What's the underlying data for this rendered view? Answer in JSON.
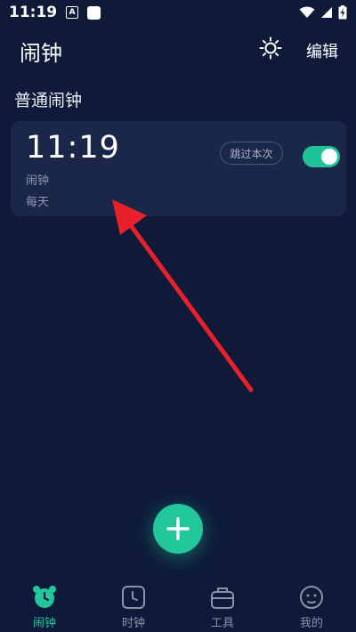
{
  "status_bar": {
    "time": "11:19",
    "badge_letter": "A"
  },
  "header": {
    "title": "闹钟",
    "edit_label": "编辑"
  },
  "section": {
    "title": "普通闹钟"
  },
  "alarm": {
    "time": "11:19",
    "label": "闹钟",
    "repeat": "每天",
    "skip_label": "跳过本次",
    "enabled": true
  },
  "bottom_nav": [
    {
      "label": "闹钟",
      "icon": "alarm-clock-icon",
      "active": true
    },
    {
      "label": "时钟",
      "icon": "clock-icon",
      "active": false
    },
    {
      "label": "工具",
      "icon": "toolbox-icon",
      "active": false
    },
    {
      "label": "我的",
      "icon": "profile-face-icon",
      "active": false
    }
  ],
  "colors": {
    "background": "#0e1a38",
    "card": "#1a2748",
    "accent": "#22c79c",
    "annotation_arrow": "#e8202a"
  }
}
